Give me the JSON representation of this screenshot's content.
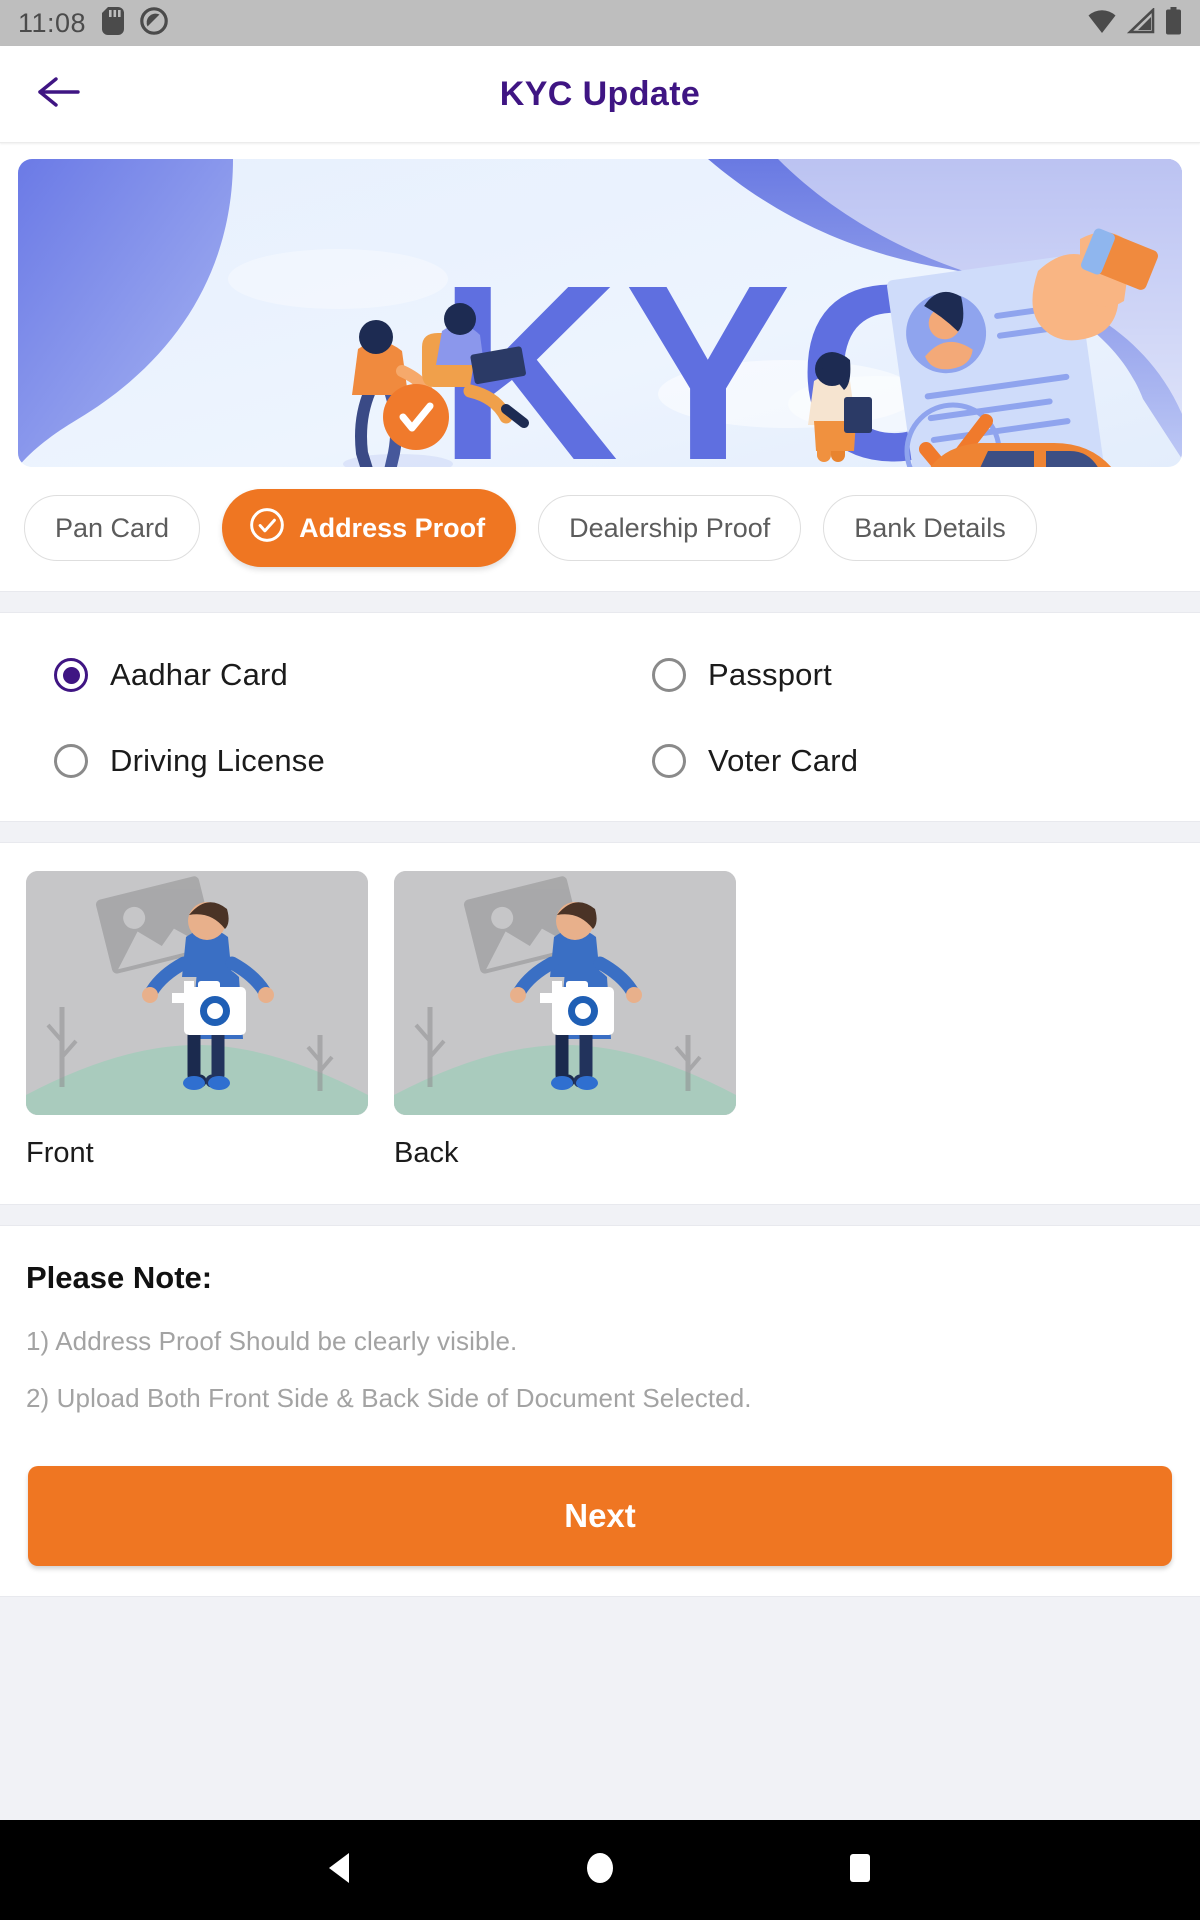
{
  "status_bar": {
    "time": "11:08",
    "icons_left": [
      "sd-card-icon",
      "do-not-disturb-icon"
    ],
    "icons_right": [
      "wifi-icon",
      "cellular-signal-icon",
      "battery-icon"
    ],
    "background_color": "#bebebe"
  },
  "header": {
    "back_icon": "arrow-left-icon",
    "title": "KYC Update",
    "title_color": "#3f1583"
  },
  "banner": {
    "alt_text": "KYC",
    "headline_text": "KYC",
    "illustration": "kyc-illustration",
    "background_color": "#e9f1fd",
    "accent_color": "#6070e0"
  },
  "tabs": {
    "items": [
      {
        "label": "Pan Card",
        "active": false,
        "icon": null
      },
      {
        "label": "Address Proof",
        "active": true,
        "icon": "check-circle-icon"
      },
      {
        "label": "Dealership Proof",
        "active": false,
        "icon": null
      },
      {
        "label": "Bank Details",
        "active": false,
        "icon": null
      }
    ],
    "active_color": "#ef7622",
    "inactive_text_color": "#5c5c5c"
  },
  "document_types": {
    "selected": "Aadhar Card",
    "selected_color": "#3f1583",
    "options": [
      {
        "label": "Aadhar Card",
        "selected": true
      },
      {
        "label": "Passport",
        "selected": false
      },
      {
        "label": "Driving License",
        "selected": false
      },
      {
        "label": "Voter Card",
        "selected": false
      }
    ]
  },
  "uploads": {
    "items": [
      {
        "label": "Front",
        "placeholder_icon": "image-placeholder-icon",
        "action_icon": "add-photo-camera-icon"
      },
      {
        "label": "Back",
        "placeholder_icon": "image-placeholder-icon",
        "action_icon": "add-photo-camera-icon"
      }
    ]
  },
  "notes": {
    "title": "Please Note:",
    "lines": [
      "1) Address Proof Should be clearly visible.",
      "2) Upload Both Front Side & Back Side of Document Selected."
    ],
    "text_color": "#a3a3a3"
  },
  "primary_action": {
    "label": "Next",
    "color": "#ef7622"
  },
  "nav_bar": {
    "buttons": [
      "back-triangle-icon",
      "home-circle-icon",
      "recents-square-icon"
    ],
    "background_color": "#000000"
  }
}
